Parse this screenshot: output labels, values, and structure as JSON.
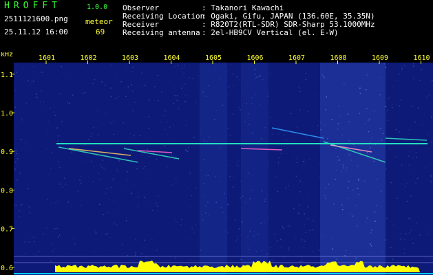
{
  "header": {
    "app_name": "HROFFT",
    "version": "1.0.0",
    "filename": "2511121600.png",
    "datetime": "25.11.12 16:00",
    "mode_label": "meteor",
    "count": "69",
    "info": [
      {
        "label": "Observer",
        "value": ": Takanori Kawachi"
      },
      {
        "label": "Receiving Location",
        "value": ": Ogaki, Gifu, JAPAN (136.60E, 35.35N)"
      },
      {
        "label": "Receiver",
        "value": ": R820T2(RTL-SDR) SDR-Sharp 53.1000MHz"
      },
      {
        "label": "Receiving antenna",
        "value": ": 2el-HB9CV Vertical (el. E-W)"
      }
    ]
  },
  "chart_data": {
    "type": "heatmap",
    "ylabel": "kHz",
    "x_ticks": [
      "1601",
      "1602",
      "1603",
      "1604",
      "1605",
      "1606",
      "1607",
      "1608",
      "1609",
      "1610"
    ],
    "y_ticks": [
      "1.1",
      "1.0",
      "0.9",
      "0.8",
      "0.7",
      "0.6"
    ],
    "ylim": [
      0.58,
      1.13
    ],
    "carrier_khz": 0.92,
    "colors": {
      "background": "#0d1a78",
      "carrier": "#22e0c0",
      "axis_text": "#ffff33",
      "amplitude": "#ffff00",
      "baseline": "#00ccff"
    }
  }
}
